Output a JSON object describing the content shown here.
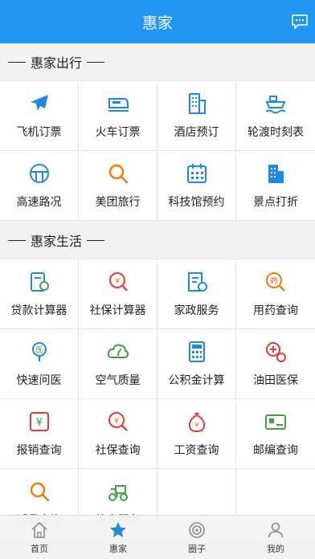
{
  "header": {
    "title": "惠家",
    "chat_icon": "chat-bubble-icon"
  },
  "section_travel": {
    "title": "惠家出行"
  },
  "travel": [
    {
      "label": "飞机订票",
      "icon": "airplane-icon"
    },
    {
      "label": "火车订票",
      "icon": "train-icon"
    },
    {
      "label": "酒店预订",
      "icon": "hotel-icon"
    },
    {
      "label": "轮渡时刻表",
      "icon": "ferry-icon"
    },
    {
      "label": "高速路况",
      "icon": "highway-icon"
    },
    {
      "label": "美团旅行",
      "icon": "search-icon"
    },
    {
      "label": "科技馆预约",
      "icon": "calendar-icon"
    },
    {
      "label": "景点打折",
      "icon": "building-icon"
    }
  ],
  "section_life": {
    "title": "惠家生活"
  },
  "life": [
    {
      "label": "贷款计算器",
      "icon": "loan-calculator-icon"
    },
    {
      "label": "社保计算器",
      "icon": "social-security-calc-icon"
    },
    {
      "label": "家政服务",
      "icon": "housekeeping-icon"
    },
    {
      "label": "用药查询",
      "icon": "medicine-search-icon"
    },
    {
      "label": "快速问医",
      "icon": "doctor-icon"
    },
    {
      "label": "空气质量",
      "icon": "air-quality-icon"
    },
    {
      "label": "公积金计算",
      "icon": "calculator-icon"
    },
    {
      "label": "油田医保",
      "icon": "medical-insurance-icon"
    },
    {
      "label": "报销查询",
      "icon": "reimbursement-icon"
    },
    {
      "label": "社保查询",
      "icon": "social-security-search-icon"
    },
    {
      "label": "工资查询",
      "icon": "salary-icon"
    },
    {
      "label": "邮编查询",
      "icon": "postcode-icon"
    },
    {
      "label": "话费查询",
      "icon": "phone-bill-search-icon"
    },
    {
      "label": "外卖服务",
      "icon": "delivery-icon"
    },
    {
      "label": "",
      "icon": ""
    },
    {
      "label": "",
      "icon": ""
    }
  ],
  "tabbar": [
    {
      "label": "首页",
      "icon": "home-icon"
    },
    {
      "label": "惠家",
      "icon": "star-icon",
      "active": true
    },
    {
      "label": "圈子",
      "icon": "circle-icon"
    },
    {
      "label": "我的",
      "icon": "profile-icon"
    }
  ],
  "colors": {
    "header": "#2196f3",
    "blue_icon": "#1e88e5",
    "orange_icon": "#f57c00",
    "red_icon": "#e53935",
    "green_icon": "#43a047"
  }
}
